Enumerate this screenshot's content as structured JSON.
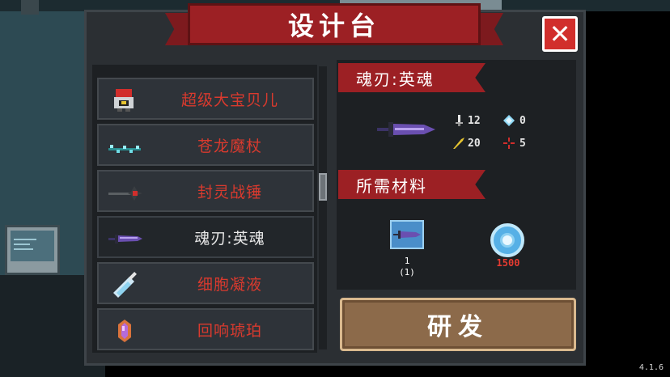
{
  "title": "设计台",
  "close_label": "✕",
  "items": [
    {
      "label": "超级大宝贝儿",
      "icon": "robot-icon",
      "selected": false
    },
    {
      "label": "苍龙魔杖",
      "icon": "staff-icon",
      "selected": false
    },
    {
      "label": "封灵战锤",
      "icon": "hammer-icon",
      "selected": false
    },
    {
      "label": "魂刃:英魂",
      "icon": "sword-icon",
      "selected": true
    },
    {
      "label": "细胞凝液",
      "icon": "syringe-icon",
      "selected": false
    },
    {
      "label": "回响琥珀",
      "icon": "amber-icon",
      "selected": false
    }
  ],
  "detail": {
    "name": "魂刃:英魂",
    "stats": {
      "damage": "12",
      "energy": "0",
      "crit": "20",
      "accuracy": "5"
    },
    "materials_title": "所需材料",
    "material_item": {
      "icon": "sword-blueprint-icon",
      "count_top": "1",
      "count_bottom": "(1)"
    },
    "gem_count": "1500"
  },
  "craft_label": "研发",
  "version": "4.1.6",
  "colors": {
    "accent": "#9c2024",
    "list_text": "#d93a2e",
    "button": "#8c6a4a",
    "gem": "#56b0e6"
  }
}
